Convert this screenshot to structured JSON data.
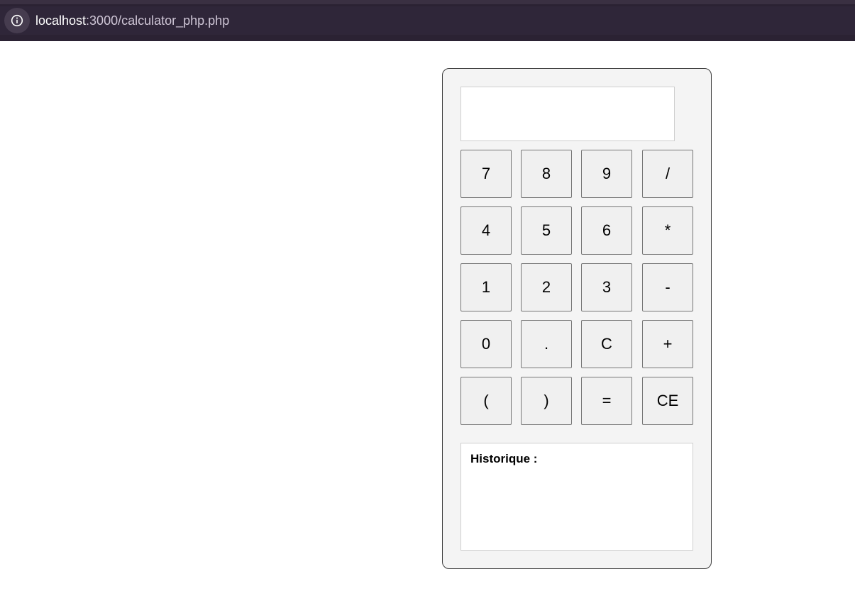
{
  "browser": {
    "url_host": "localhost",
    "url_path": ":3000/calculator_php.php"
  },
  "calculator": {
    "display_value": "",
    "keys": {
      "k7": "7",
      "k8": "8",
      "k9": "9",
      "kdiv": "/",
      "k4": "4",
      "k5": "5",
      "k6": "6",
      "kmul": "*",
      "k1": "1",
      "k2": "2",
      "k3": "3",
      "ksub": "-",
      "k0": "0",
      "kdot": ".",
      "kclear": "C",
      "kadd": "+",
      "klparen": "(",
      "krparen": ")",
      "keq": "=",
      "kce": "CE"
    },
    "history_title": "Historique :"
  }
}
